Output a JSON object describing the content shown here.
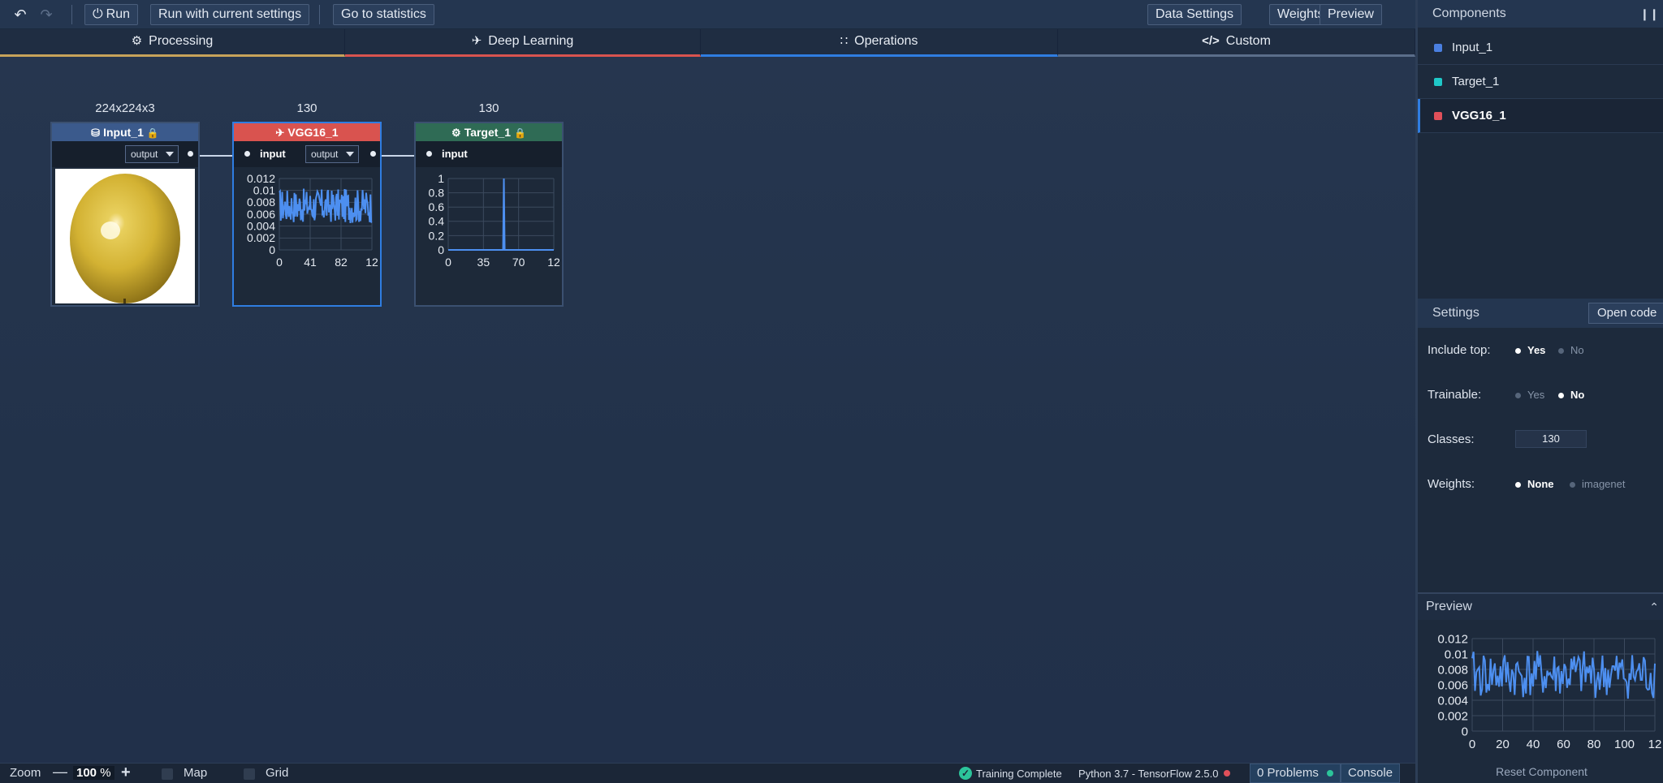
{
  "toolbar": {
    "undo_icon": "undo-icon",
    "redo_icon": "redo-icon",
    "run_label": "Run",
    "run_current_label": "Run with current settings",
    "stats_label": "Go to statistics",
    "data_settings_label": "Data Settings",
    "weights_label": "Weights",
    "preview_label": "Preview"
  },
  "tabs": [
    {
      "label": "Processing",
      "icon": "gear-icon",
      "color": "#c7a35a"
    },
    {
      "label": "Deep Learning",
      "icon": "plane-icon",
      "color": "#d9534f"
    },
    {
      "label": "Operations",
      "icon": "grid-dots-icon",
      "color": "#2f7de1"
    },
    {
      "label": "Custom",
      "icon": "code-icon",
      "color": "#5b6e8a"
    }
  ],
  "nodes": {
    "input": {
      "title": "Input_1",
      "dims": "224x224x3",
      "output": "output",
      "color": "#3b5a8c",
      "icon": "database-icon"
    },
    "vgg": {
      "title": "VGG16_1",
      "dims": "130",
      "input": "input",
      "output": "output",
      "color": "#d9534f",
      "icon": "plane-icon"
    },
    "target": {
      "title": "Target_1",
      "dims": "130",
      "input": "input",
      "color": "#2f6b55",
      "icon": "gear-icon"
    }
  },
  "chart_data": [
    {
      "type": "line",
      "name": "vgg-node-output",
      "ylim": [
        0,
        0.012
      ],
      "y_ticks": [
        "0.012",
        "0.01",
        "0.008",
        "0.006",
        "0.004",
        "0.002",
        "0"
      ],
      "x_ticks": [
        "0",
        "41",
        "82",
        "12"
      ],
      "x_range": [
        0,
        129
      ],
      "series_summary": "noisy signal, 130 points, values approx 0.0045–0.0105"
    },
    {
      "type": "line",
      "name": "target-node-output",
      "ylim": [
        0,
        1
      ],
      "y_ticks": [
        "1",
        "0.8",
        "0.6",
        "0.4",
        "0.2",
        "0"
      ],
      "x_ticks": [
        "0",
        "35",
        "70",
        "12"
      ],
      "x_range": [
        0,
        129
      ],
      "spike": {
        "x": 68,
        "y": 1
      }
    },
    {
      "type": "line",
      "name": "preview",
      "ylim": [
        0,
        0.012
      ],
      "y_ticks": [
        "0.012",
        "0.01",
        "0.008",
        "0.006",
        "0.004",
        "0.002",
        "0"
      ],
      "x_ticks": [
        "0",
        "20",
        "40",
        "60",
        "80",
        "100",
        "12"
      ],
      "x_range": [
        0,
        129
      ]
    }
  ],
  "components": {
    "title": "Components",
    "items": [
      {
        "label": "Input_1",
        "color": "#4a7fe0"
      },
      {
        "label": "Target_1",
        "color": "#1fc8c8"
      },
      {
        "label": "VGG16_1",
        "color": "#e0505a"
      }
    ]
  },
  "settings": {
    "title": "Settings",
    "open_code": "Open code",
    "include_top": {
      "label": "Include top:",
      "options": [
        "Yes",
        "No"
      ],
      "selected": "Yes"
    },
    "trainable": {
      "label": "Trainable:",
      "options": [
        "Yes",
        "No"
      ],
      "selected": "No"
    },
    "classes": {
      "label": "Classes:",
      "value": "130"
    },
    "weights": {
      "label": "Weights:",
      "options": [
        "None",
        "imagenet"
      ],
      "selected": "None"
    }
  },
  "preview": {
    "title": "Preview",
    "reset": "Reset Component"
  },
  "status": {
    "zoom_label": "Zoom",
    "zoom_value": "100",
    "zoom_unit": "%",
    "map_label": "Map",
    "grid_label": "Grid",
    "training": "Training Complete",
    "python": "Python 3.7 - TensorFlow 2.5.0",
    "problems": "0 Problems",
    "console": "Console"
  }
}
